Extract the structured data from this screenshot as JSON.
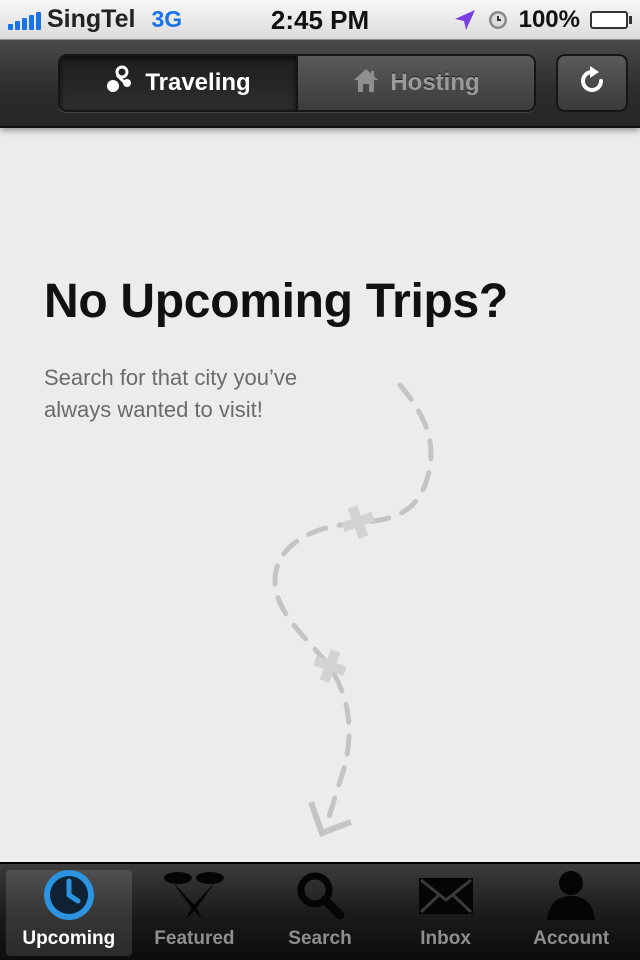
{
  "status_bar": {
    "carrier": "SingTel",
    "network": "3G",
    "time": "2:45 PM",
    "battery": "100%",
    "battery_level": 1.0,
    "icons": [
      "signal-bars",
      "location-arrow",
      "alarm-clock",
      "battery"
    ]
  },
  "nav": {
    "segments": [
      {
        "label": "Traveling",
        "icon": "traveling-icon",
        "selected": true
      },
      {
        "label": "Hosting",
        "icon": "house-icon",
        "selected": false
      }
    ],
    "refresh_icon": "refresh-icon"
  },
  "main": {
    "headline": "No Upcoming Trips?",
    "subtext": "Search for that city you’ve always wanted to visit!",
    "illustration": "dashed-trip-path"
  },
  "tab_bar": {
    "tabs": [
      {
        "label": "Upcoming",
        "icon": "clock-icon",
        "selected": true
      },
      {
        "label": "Featured",
        "icon": "featured-icon",
        "selected": false
      },
      {
        "label": "Search",
        "icon": "search-icon",
        "selected": false
      },
      {
        "label": "Inbox",
        "icon": "envelope-icon",
        "selected": false
      },
      {
        "label": "Account",
        "icon": "person-icon",
        "selected": false
      }
    ]
  },
  "colors": {
    "accent_blue": "#1a73e8",
    "clock_blue": "#2b93e0",
    "background": "#ececec",
    "nav_dark": "#2c2c2c",
    "battery_green": "#2aa400",
    "location_purple": "#7b3fe4"
  }
}
